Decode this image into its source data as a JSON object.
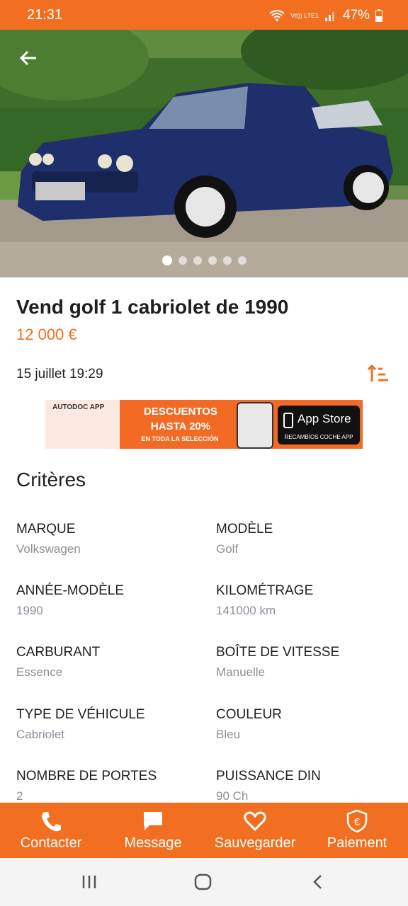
{
  "status_bar": {
    "time": "21:31",
    "network": "Vo)) LTE1",
    "battery": "47%"
  },
  "gallery": {
    "image": "blue Volkswagen Golf cabriolet photo",
    "dot_count": 6,
    "active_dot": 1
  },
  "listing": {
    "title": "Vend golf 1 cabriolet de 1990",
    "price": "12 000 €",
    "date": "15 juillet 19:29"
  },
  "banner": {
    "brand": "AUTODOC APP",
    "line1": "DESCUENTOS",
    "line2": "HASTA 20%",
    "line3": "EN TODA LA SELECCIÓN",
    "store": "App Store",
    "store_sub": "RECAMBIOS COCHE APP"
  },
  "criteria": {
    "heading": "Critères",
    "items": [
      {
        "label": "MARQUE",
        "value": "Volkswagen"
      },
      {
        "label": "MODÈLE",
        "value": "Golf"
      },
      {
        "label": "ANNÉE-MODÈLE",
        "value": "1990"
      },
      {
        "label": "KILOMÉTRAGE",
        "value": "141000 km"
      },
      {
        "label": "CARBURANT",
        "value": "Essence"
      },
      {
        "label": "BOÎTE DE VITESSE",
        "value": "Manuelle"
      },
      {
        "label": "TYPE DE VÉHICULE",
        "value": "Cabriolet"
      },
      {
        "label": "COULEUR",
        "value": "Bleu"
      },
      {
        "label": "NOMBRE DE PORTES",
        "value": "2"
      },
      {
        "label": "PUISSANCE DIN",
        "value": "90 Ch"
      }
    ]
  },
  "actions": {
    "contact": "Contacter",
    "message": "Message",
    "save": "Sauvegarder",
    "payment": "Paiement"
  },
  "colors": {
    "accent": "#f26f21",
    "muted": "#8a8f99"
  }
}
